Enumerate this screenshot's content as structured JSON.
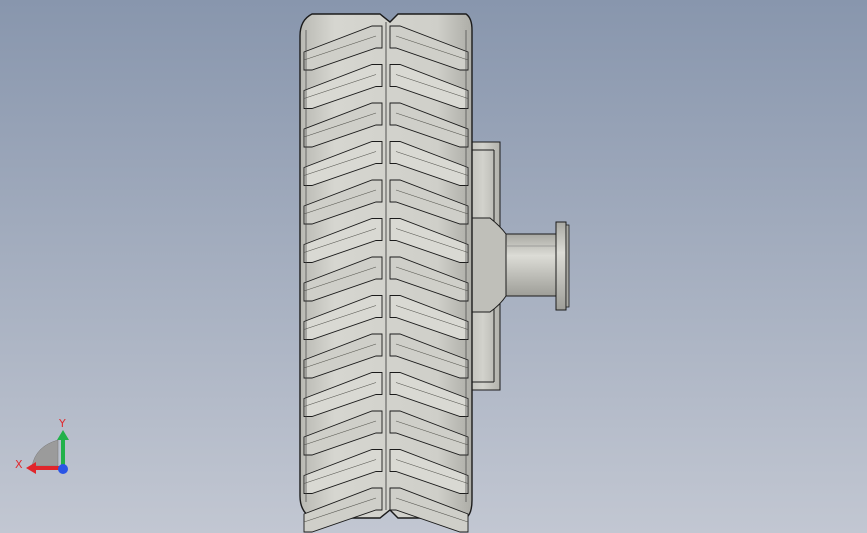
{
  "viewport": {
    "background_top": "#8896ad",
    "background_bottom": "#c2c7d2",
    "part_fill": "#c9c9c3",
    "part_shade": "#a8a8a2",
    "part_dark": "#8d8d87",
    "edge_color": "#1b1b1b",
    "highlight": "#f4f4f2"
  },
  "tire": {
    "tread_pattern": "chevron"
  },
  "hub": {
    "name": "hub-and-axle-stub"
  },
  "triad": {
    "y_label": "Y",
    "x_label": "X",
    "y_color": "#21b14a",
    "x_color": "#e0252b",
    "z_color": "#2a55e6",
    "label_color": "#e02a2f"
  }
}
